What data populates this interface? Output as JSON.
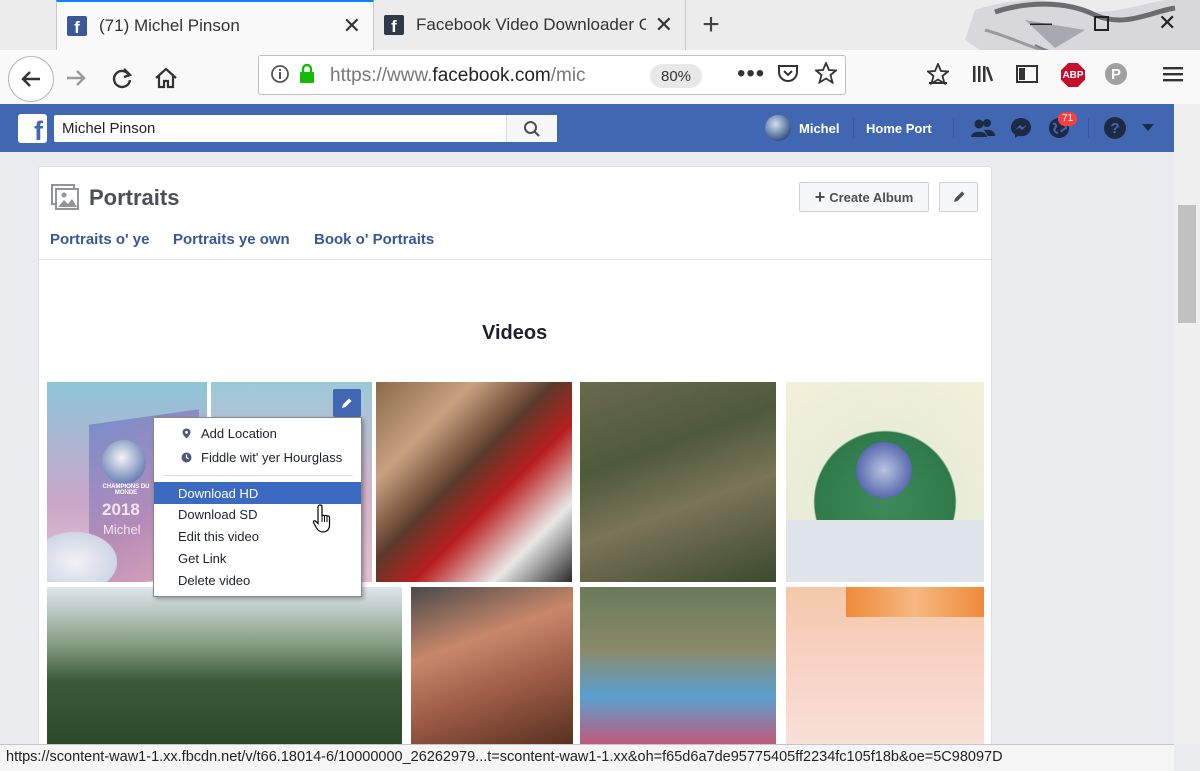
{
  "browser": {
    "tabs": [
      {
        "title": "(71) Michel Pinson",
        "active": true
      },
      {
        "title": "Facebook Video Downloader O",
        "active": false
      }
    ],
    "url": {
      "prefix": "https://www.",
      "domain": "facebook.com",
      "path": "/mic"
    },
    "zoom": "80%",
    "abp_label": "ABP",
    "status_url": "https://scontent-waw1-1.xx.fbcdn.net/v/t66.18014-6/10000000_26262979...t=scontent-waw1-1.xx&oh=f65d6a7de95775405ff2234fc105f18b&oe=5C98097D"
  },
  "facebook": {
    "search_value": "Michel Pinson",
    "user_name": "Michel",
    "home_label": "Home Port",
    "notifications_count": "71"
  },
  "album": {
    "title": "Portraits",
    "create_album_label": "Create Album",
    "tabs": [
      "Portraits o' ye",
      "Portraits ye own",
      "Book o' Portraits"
    ],
    "section_title": "Videos",
    "thumb_text": {
      "year": "2018",
      "name": "Michel",
      "logo": "CHAMPIONS DU MONDE"
    }
  },
  "context_menu": {
    "items": [
      {
        "label": "Add Location",
        "icon": "location-pin-icon"
      },
      {
        "label": "Fiddle wit' yer Hourglass",
        "icon": "clock-icon"
      },
      {
        "label": "Download HD",
        "highlighted": true
      },
      {
        "label": "Download SD"
      },
      {
        "label": "Edit this video"
      },
      {
        "label": "Get Link"
      },
      {
        "label": "Delete video"
      }
    ]
  },
  "colors": {
    "fb_blue": "#4267b2",
    "menu_highlight": "#3c6ac3",
    "link_blue": "#365899",
    "tab_accent": "#0a84ff"
  }
}
